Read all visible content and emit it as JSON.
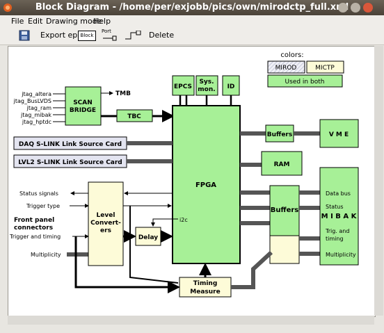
{
  "window": {
    "title": "Block Diagram - /home/per/exjobb/pics/own/mirodctp_full.xml"
  },
  "menu": [
    "File",
    "Edit",
    "Drawing mode",
    "Help"
  ],
  "toolbar": {
    "export_label": "Export eps",
    "block_label": "Block",
    "port_label": "Port",
    "delete_label": "Delete"
  },
  "legend": {
    "title": "colors:",
    "mirod": "MIROD",
    "mictp": "MICTP",
    "both": "Used in both"
  },
  "blocks": {
    "scan_bridge": [
      "SCAN",
      "BRIDGE"
    ],
    "tmb": "TMB",
    "tbc": "TBC",
    "epcs": "EPCS",
    "sysmon": [
      "Sys.",
      "mon."
    ],
    "id": "ID",
    "fpga": "FPGA",
    "i2c": "i2c",
    "buffers_top": "Buffers",
    "vme": "V M E",
    "ram": "RAM",
    "daq": "DAQ S-LINK Link Source Card",
    "lvl2": "LVL2 S-LINK Link Source Card",
    "level": [
      "Level",
      "Convert-",
      "ers"
    ],
    "delay": "Delay",
    "buffers_mid": "Buffers",
    "timing": [
      "Timing",
      "Measure"
    ],
    "mibak_title": "M I B A K",
    "mibak_lines": [
      "Data bus",
      "Status",
      "Trig. and",
      "timing",
      "Multiplicity"
    ]
  },
  "jtag": [
    "jtag_altera",
    "jtag_BusLVDS",
    "jtag_ram",
    "jtag_mibak",
    "jtag_hptdc"
  ],
  "left_labels": {
    "status": "Status signals",
    "trigtype": "Trigger type",
    "front": [
      "Front panel",
      "connectors"
    ],
    "trigtiming": "Trigger and timing",
    "mult": "Multiplicity"
  },
  "colors": {
    "green": "#a7f097",
    "cream": "#fdfbd8",
    "hatch": "#e3e4f0",
    "stroke": "#000000"
  }
}
